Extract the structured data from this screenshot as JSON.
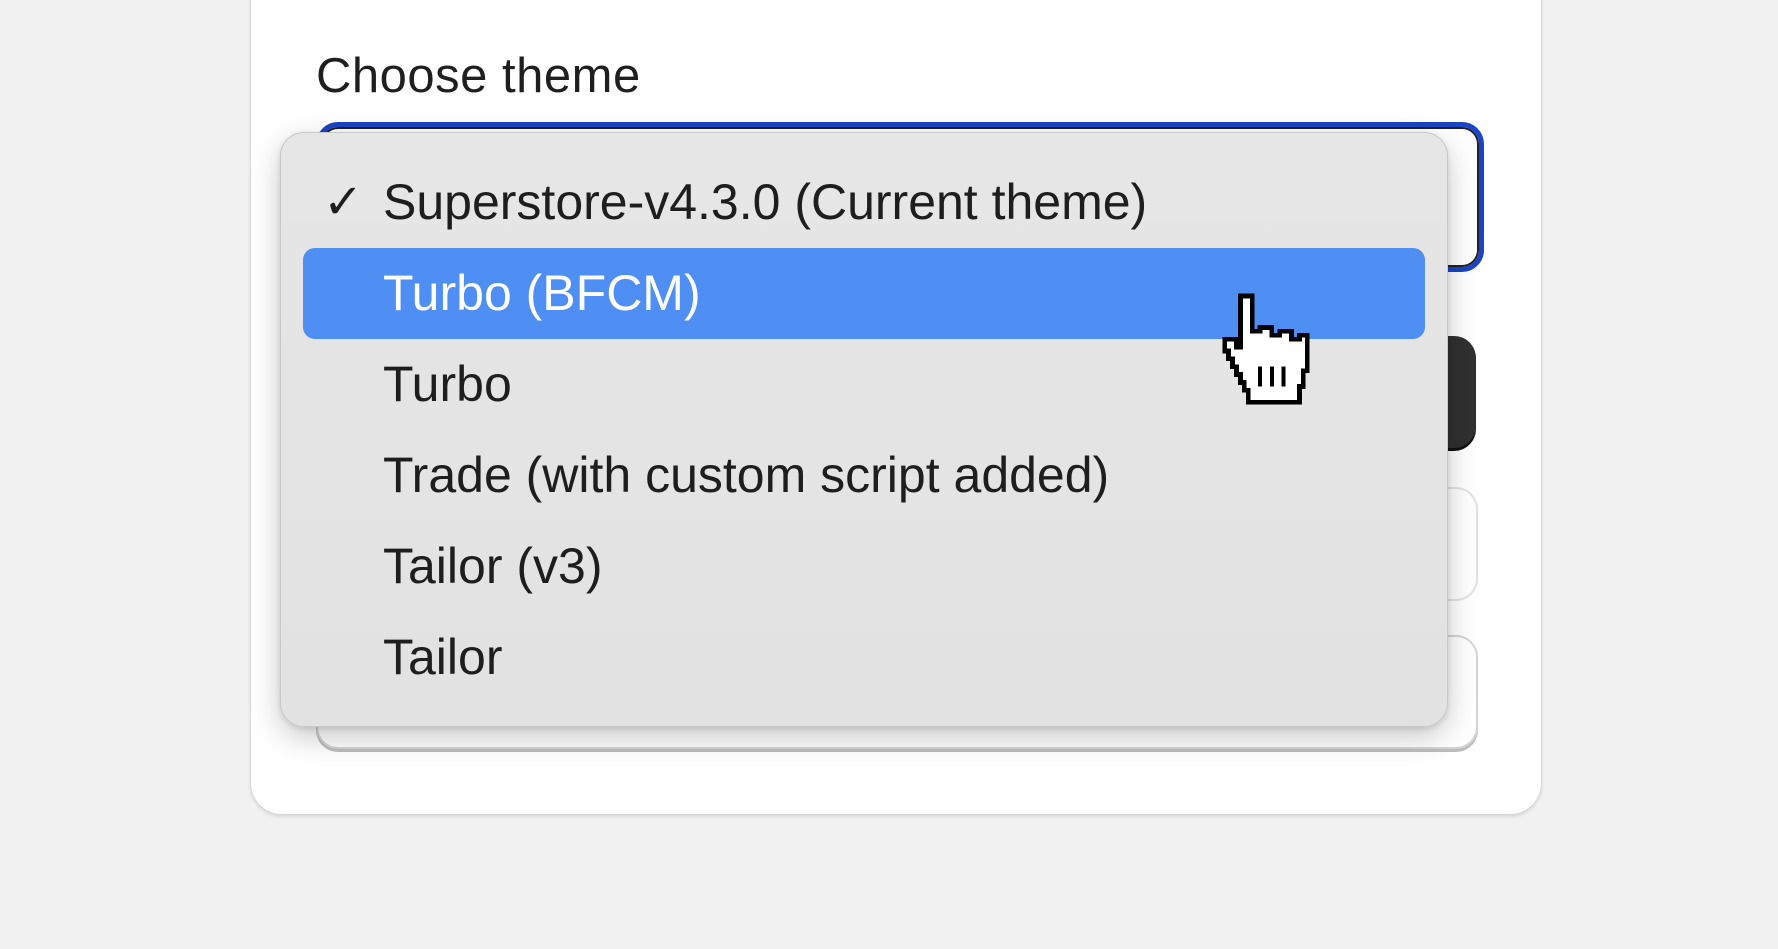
{
  "form": {
    "label": "Choose theme"
  },
  "theme_select": {
    "options": [
      {
        "label": "Superstore-v4.3.0 (Current theme)",
        "checked": true,
        "highlighted": false
      },
      {
        "label": "Turbo (BFCM)",
        "checked": false,
        "highlighted": true
      },
      {
        "label": "Turbo",
        "checked": false,
        "highlighted": false
      },
      {
        "label": "Trade (with custom script added)",
        "checked": false,
        "highlighted": false
      },
      {
        "label": "Tailor (v3)",
        "checked": false,
        "highlighted": false
      },
      {
        "label": "Tailor",
        "checked": false,
        "highlighted": false
      }
    ],
    "check_glyph": "✓"
  },
  "colors": {
    "focus_ring": "#1b45c6",
    "highlight": "#4f8ef2",
    "menu_bg": "#e4e4e4"
  },
  "cursor": {
    "icon": "pointer-hand-icon"
  }
}
